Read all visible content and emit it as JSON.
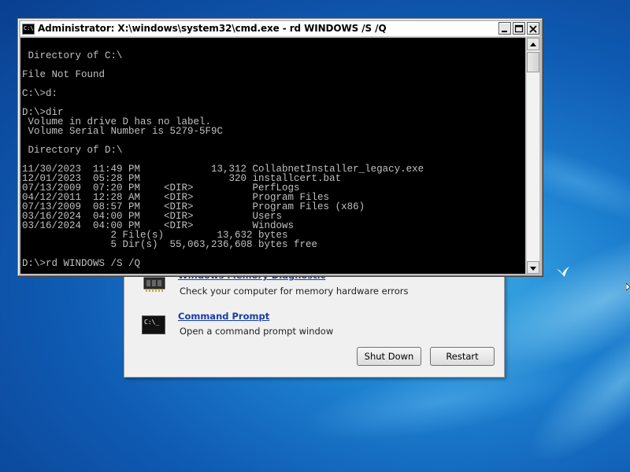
{
  "cmd": {
    "title": "Administrator: X:\\windows\\system32\\cmd.exe - rd  WINDOWS /S /Q",
    "icon_label": "C:\\",
    "console_lines": [
      "",
      " Directory of C:\\",
      "",
      "File Not Found",
      "",
      "C:\\>d:",
      "",
      "D:\\>dir",
      " Volume in drive D has no label.",
      " Volume Serial Number is 5279-5F9C",
      "",
      " Directory of D:\\",
      "",
      "11/30/2023  11:49 PM            13,312 CollabnetInstaller_legacy.exe",
      "12/01/2023  05:28 PM               320 installcert.bat",
      "07/13/2009  07:20 PM    <DIR>          PerfLogs",
      "04/12/2011  12:28 AM    <DIR>          Program Files",
      "07/13/2009  08:57 PM    <DIR>          Program Files (x86)",
      "03/16/2024  04:00 PM    <DIR>          Users",
      "03/16/2024  04:00 PM    <DIR>          Windows",
      "               2 File(s)         13,632 bytes",
      "               5 Dir(s)  55,063,236,608 bytes free",
      "",
      "D:\\>rd WINDOWS /S /Q"
    ]
  },
  "recovery": {
    "items": [
      {
        "title": "Windows Memory Diagnostic",
        "desc": "Check your computer for memory hardware errors",
        "icon": "memory-chip-icon"
      },
      {
        "title": "Command Prompt",
        "desc": "Open a command prompt window",
        "icon": "command-prompt-icon"
      }
    ],
    "cmd_icon_label": "C:\\_",
    "shutdown_label": "Shut Down",
    "restart_label": "Restart"
  },
  "colors": {
    "desktop": "#1565c0",
    "console_bg": "#000000",
    "console_fg": "#c0c0c0",
    "link": "#1a3da0"
  }
}
